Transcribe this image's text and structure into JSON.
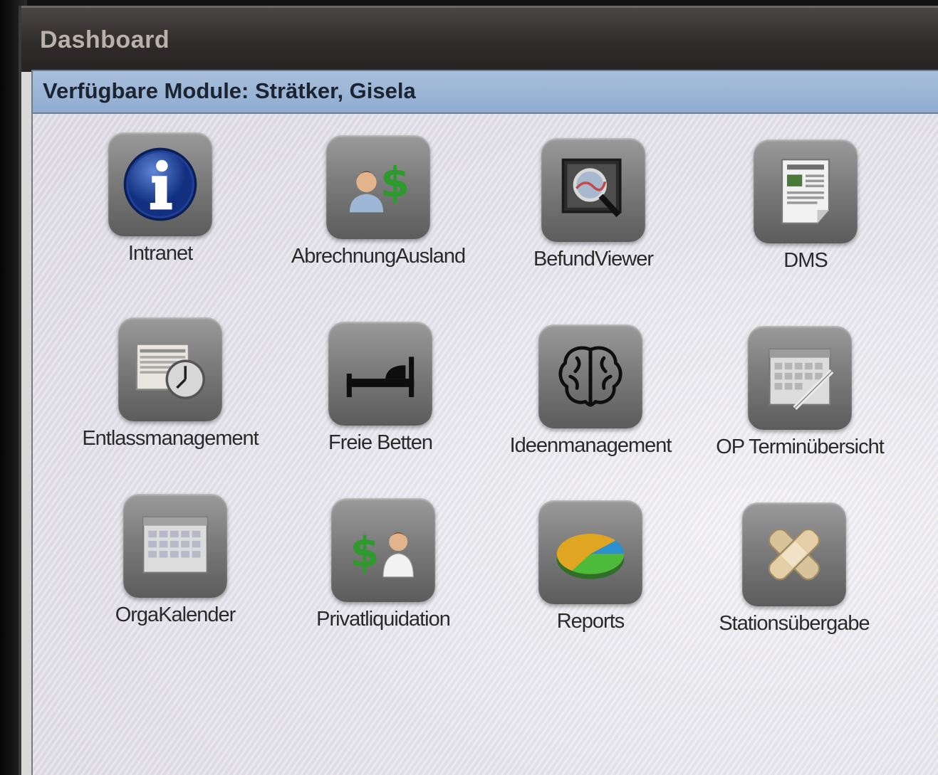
{
  "window": {
    "title": "Dashboard"
  },
  "header": {
    "text": "Verfügbare Module: Strätker, Gisela"
  },
  "modules": [
    {
      "label": "Intranet",
      "icon": "info-icon"
    },
    {
      "label": "AbrechnungAusland",
      "icon": "person-dollar-icon"
    },
    {
      "label": "BefundViewer",
      "icon": "magnifier-scan-icon"
    },
    {
      "label": "DMS",
      "icon": "document-icon"
    },
    {
      "label": "Entlassmanagement",
      "icon": "document-clock-icon"
    },
    {
      "label": "Freie Betten",
      "icon": "bed-icon"
    },
    {
      "label": "Ideenmanagement",
      "icon": "brain-icon"
    },
    {
      "label": "OP Terminübersicht",
      "icon": "calendar-pen-icon"
    },
    {
      "label": "OrgaKalender",
      "icon": "calendar-icon"
    },
    {
      "label": "Privatliquidation",
      "icon": "dollar-doctor-icon"
    },
    {
      "label": "Reports",
      "icon": "pie-chart-icon"
    },
    {
      "label": "Stationsübergabe",
      "icon": "bandage-icon"
    }
  ]
}
